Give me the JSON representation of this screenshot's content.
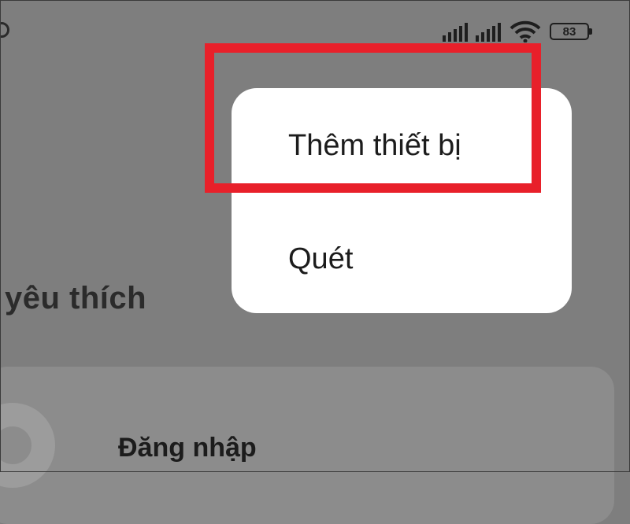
{
  "status_bar": {
    "icons": [
      "signal-icon",
      "signal-icon",
      "wifi-icon",
      "battery-icon"
    ],
    "battery_level": "83"
  },
  "background": {
    "section_heading": "yêu thích",
    "login_label": "Đăng nhập"
  },
  "popup_menu": {
    "items": [
      {
        "label": "Thêm thiết bị"
      },
      {
        "label": "Quét"
      }
    ]
  },
  "annotation": {
    "highlight_color": "#e8202a",
    "highlighted_item": "Thêm thiết bị"
  }
}
